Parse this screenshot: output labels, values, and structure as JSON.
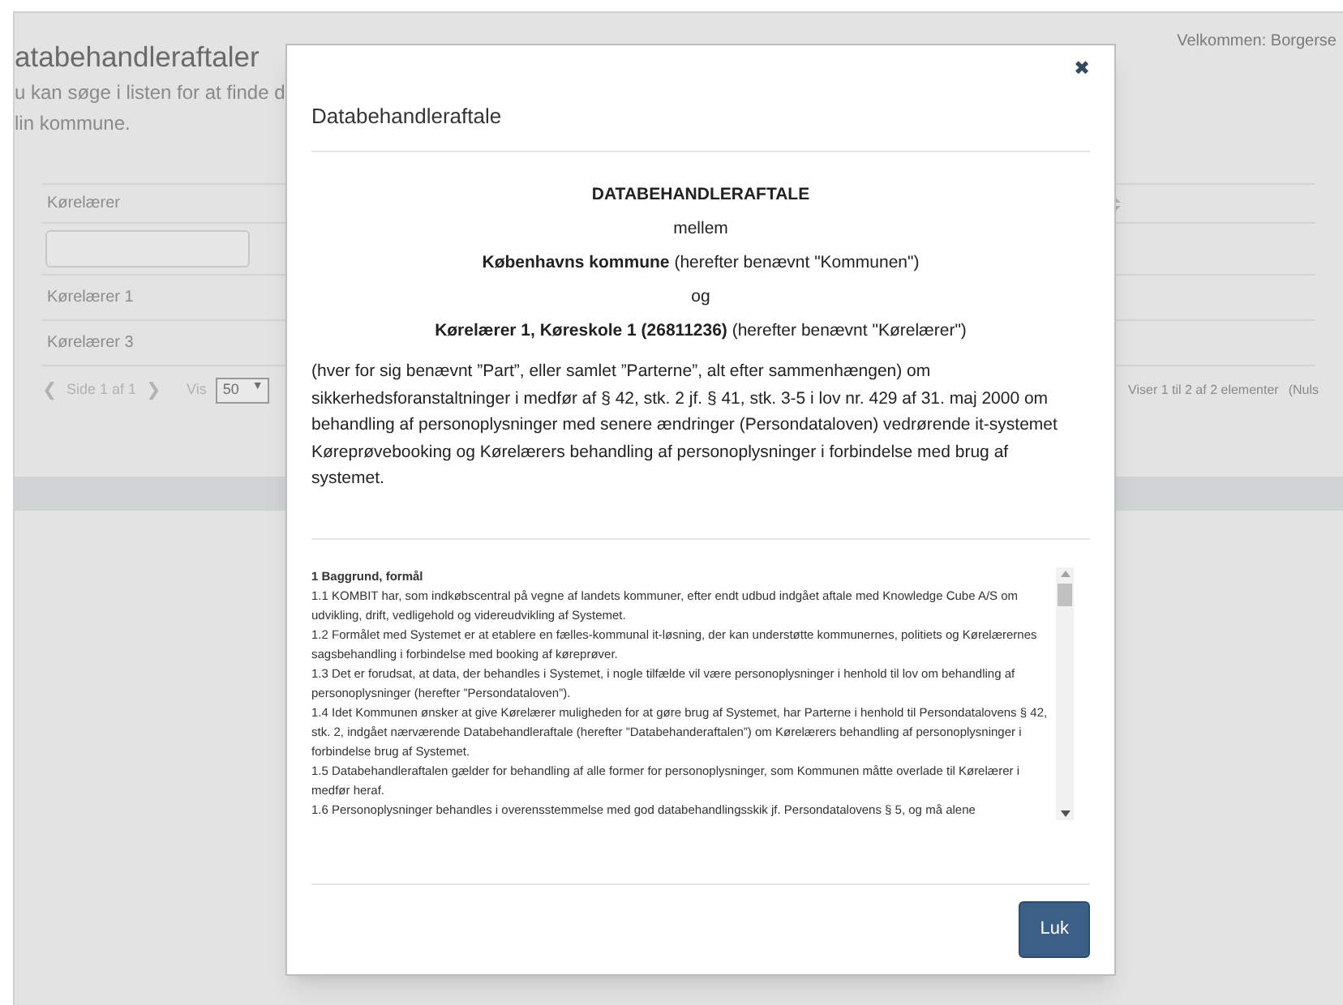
{
  "page": {
    "title": "atabehandleraftaler",
    "intro_lines": [
      "u kan søge i listen for at finde d",
      "lin kommune."
    ],
    "welcome": "Velkommen: Borgerse"
  },
  "table": {
    "columns": [
      {
        "label": "Kørelærer"
      }
    ],
    "rows": [
      [
        "Kørelærer 1"
      ],
      [
        "Kørelærer 3"
      ]
    ],
    "pager": {
      "prev": "❮",
      "page": "Side 1 af 1",
      "next": "❯",
      "show_label": "Vis",
      "page_size": "50",
      "caret": "▼",
      "summary": "Viser 1 til 2 af 2 elementer",
      "extra": "(Nuls"
    }
  },
  "modal": {
    "title": "Databehandleraftale",
    "close": "✖",
    "center_lines": [
      "**DATABEHANDLERAFTALE**",
      "mellem",
      "**Københavns kommune** (herefter benævnt \"Kommunen\")",
      "og",
      "**Kørelærer 1, Køreskole 1 (26811236)** (herefter benævnt \"Kørelærer\")"
    ],
    "paragraph": "(hver for sig benævnt ”Part”, eller samlet ”Parterne”, alt efter sammenhængen) om sikkerhedsforanstaltninger i medfør af § 42, stk. 2 jf. § 41, stk. 3-5 i lov nr. 429 af 31. maj 2000 om behandling af personoplysninger med senere ændringer (Persondataloven) vedrørende it-systemet Køreprøvebooking og Kørelærers behandling af personoplysninger i forbindelse med brug af systemet.",
    "agreement": {
      "heading": "1 Baggrund, formål",
      "clauses": [
        "1.1 KOMBIT har, som indkøbscentral på vegne af landets kommuner, efter endt udbud indgået aftale med Knowledge Cube A/S om udvikling, drift, vedligehold og videreudvikling af Systemet.",
        "1.2 Formålet med Systemet er at etablere en fælles-kommunal it-løsning, der kan understøtte kommunernes, politiets og Kørelærernes sagsbehandling i forbindelse med booking af køreprøver.",
        "1.3 Det er forudsat, at data, der behandles i Systemet, i nogle tilfælde vil være personoplysninger i henhold til lov om behandling af personoplysninger (herefter ”Persondataloven”).",
        "1.4 Idet Kommunen ønsker at give Kørelærer muligheden for at gøre brug af Systemet, har Parterne i henhold til Persondatalovens § 42, stk. 2, indgået nærværende Databehandleraftale (herefter ”Databehanderaftalen”) om Kørelærers behandling af personoplysninger i forbindelse brug af Systemet.",
        "1.5 Databehandleraftalen gælder for behandling af alle former for personoplysninger, som Kommunen måtte overlade til Kørelærer i medfør heraf.",
        "1.6 Personoplysninger behandles i overensstemmelse med god databehandlingsskik jf. Persondatalovens § 5, og må alene"
      ]
    },
    "button": "Luk"
  }
}
